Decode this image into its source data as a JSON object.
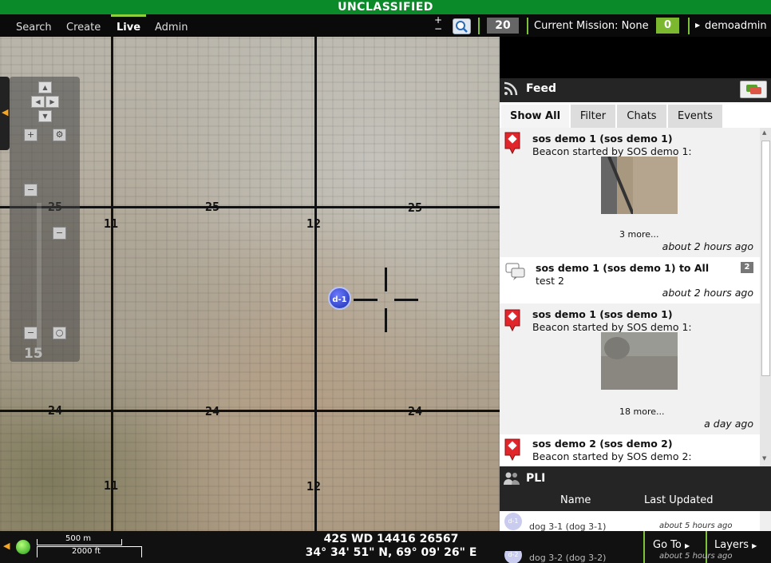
{
  "banner": {
    "text": "UNCLASSIFIED"
  },
  "nav": {
    "search": "Search",
    "create": "Create",
    "live": "Live",
    "admin": "Admin"
  },
  "toolbar": {
    "zoom_in": "+",
    "zoom_out": "−",
    "count": "20",
    "mission_label": "Current Mission: None",
    "mission_count": "0",
    "user": "demoadmin"
  },
  "map": {
    "grid_labels": [
      "25",
      "25",
      "25",
      "11",
      "12",
      "24",
      "24",
      "24",
      "11",
      "12"
    ],
    "zoom_level": "15",
    "marker_label": "d-1"
  },
  "bottombar": {
    "scale_m": "500 m",
    "scale_ft": "2000 ft",
    "mgrs": "42S WD 14416 26567",
    "latlon": "34° 34' 51\" N, 69° 09' 26\" E",
    "goto": "Go To",
    "layers": "Layers"
  },
  "feed": {
    "title": "Feed",
    "tabs": [
      "Show All",
      "Filter",
      "Chats",
      "Events"
    ],
    "items": [
      {
        "title": "sos demo 1 (sos demo 1)",
        "body": "Beacon started by SOS demo 1:",
        "more": "3 more...",
        "time": "about 2 hours ago"
      },
      {
        "title": "sos demo 1 (sos demo 1) to All",
        "body": "test 2",
        "badge": "2",
        "time": "about 2 hours ago"
      },
      {
        "title": "sos demo 1 (sos demo 1)",
        "body": "Beacon started by SOS demo 1:",
        "more": "18 more...",
        "time": "a day ago"
      },
      {
        "title": "sos demo 2 (sos demo 2)",
        "body": "Beacon started by SOS demo 2:"
      }
    ]
  },
  "pli": {
    "title": "PLI",
    "col_name": "Name",
    "col_updated": "Last Updated",
    "rows": [
      {
        "name": "dog 3-1 (dog 3-1)",
        "updated": "about 5 hours ago",
        "avatar": "d-1"
      },
      {
        "name": "dog 3-2 (dog 3-2)",
        "updated": "about 5 hours ago",
        "avatar": "d-2"
      }
    ]
  },
  "colors": {
    "banner": "#0b8a2a",
    "accent": "#7ec23a",
    "pin": "#e0262b"
  }
}
